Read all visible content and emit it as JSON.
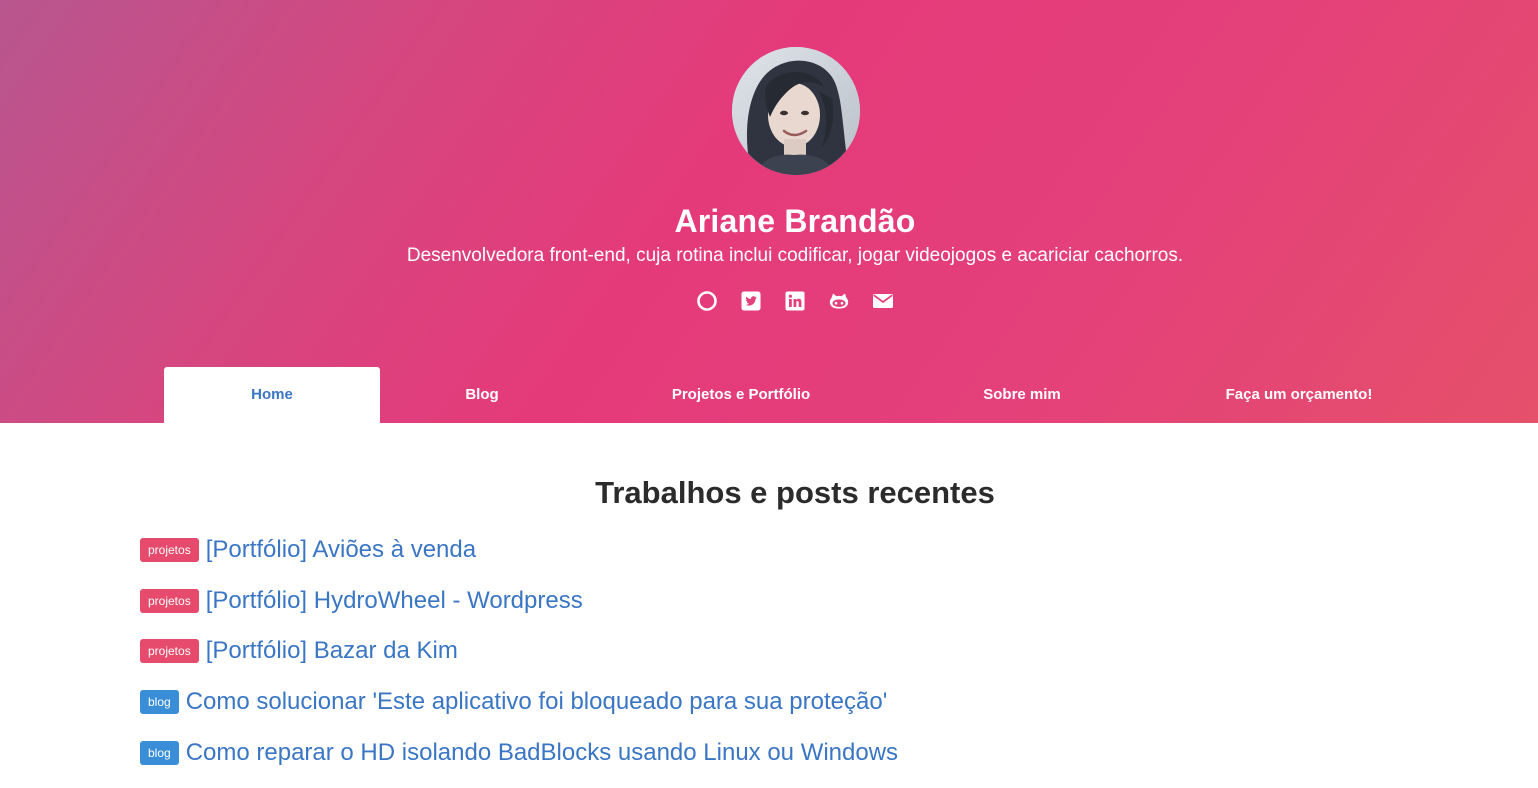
{
  "profile": {
    "name": "Ariane Brandão",
    "bio": "Desenvolvedora front-end, cuja rotina inclui codificar, jogar videojogos e acariciar cachorros."
  },
  "socials": [
    {
      "icon": "circle-icon"
    },
    {
      "icon": "twitter-icon"
    },
    {
      "icon": "linkedin-icon"
    },
    {
      "icon": "github-icon"
    },
    {
      "icon": "email-icon"
    }
  ],
  "nav": {
    "items": [
      {
        "label": "Home",
        "active": true
      },
      {
        "label": "Blog"
      },
      {
        "label": "Projetos e Portfólio"
      },
      {
        "label": "Sobre mim"
      },
      {
        "label": "Faça um orçamento!"
      }
    ]
  },
  "main": {
    "title": "Trabalhos e posts recentes",
    "posts": [
      {
        "tag": "projetos",
        "title": "[Portfólio] Aviões à venda"
      },
      {
        "tag": "projetos",
        "title": "[Portfólio] HydroWheel - Wordpress"
      },
      {
        "tag": "projetos",
        "title": "[Portfólio] Bazar da Kim"
      },
      {
        "tag": "blog",
        "title": "Como solucionar 'Este aplicativo foi bloqueado para sua proteção'"
      },
      {
        "tag": "blog",
        "title": "Como reparar o HD isolando BadBlocks usando Linux ou Windows"
      }
    ]
  },
  "colors": {
    "gradient_start": "#b8568f",
    "gradient_mid": "#e53a7a",
    "gradient_end": "#e5506a",
    "link": "#3a76c4",
    "tag_projetos": "#e64a6c",
    "tag_blog": "#3a8ed8"
  }
}
